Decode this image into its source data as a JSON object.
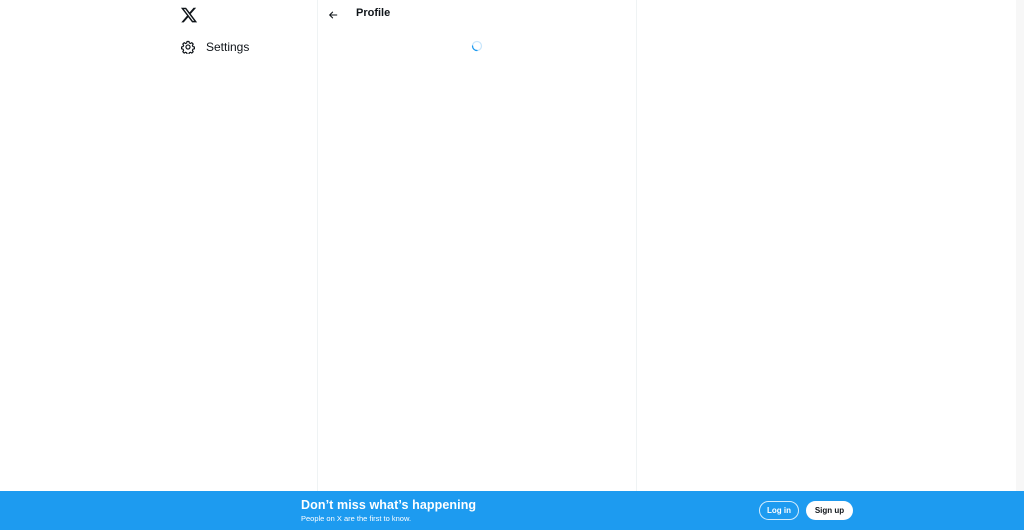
{
  "nav": {
    "logo_icon": "x-logo-icon",
    "items": [
      {
        "label": "Settings",
        "icon": "gear-icon"
      }
    ]
  },
  "main": {
    "back_icon": "arrow-left-icon",
    "title": "Profile",
    "loading_icon": "spinner-icon"
  },
  "banner": {
    "headline": "Don’t miss what’s happening",
    "subtext": "People on X are the first to know.",
    "login_label": "Log in",
    "signup_label": "Sign up"
  },
  "colors": {
    "brand_blue": "#1d9bf0",
    "text": "#0f1419",
    "divider": "#eff3f4"
  }
}
